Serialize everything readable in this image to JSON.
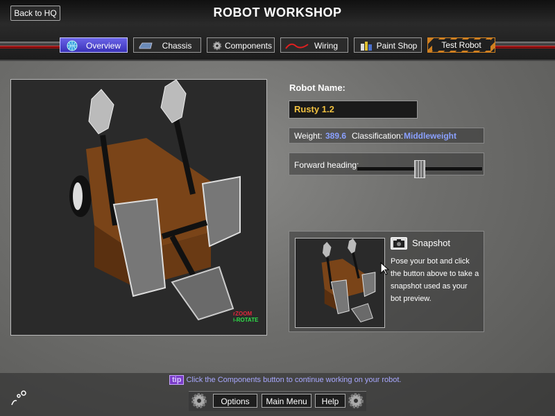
{
  "header": {
    "title": "ROBOT WORKSHOP",
    "back_label": "Back to HQ"
  },
  "tabs": [
    {
      "label": "Overview",
      "icon": "globe-icon",
      "active": true
    },
    {
      "label": "Chassis",
      "icon": "chassis-icon",
      "active": false
    },
    {
      "label": "Components",
      "icon": "gear-icon",
      "active": false
    },
    {
      "label": "Wiring",
      "icon": "wire-icon",
      "active": false
    },
    {
      "label": "Paint Shop",
      "icon": "paint-cans-icon",
      "active": false
    },
    {
      "label": "Test Robot",
      "icon": "",
      "active": false
    }
  ],
  "viewport": {
    "zoom_hint": "ZOOM",
    "rotate_hint": "ROTATE",
    "mouse_icon": "mouse-icon"
  },
  "robot": {
    "name_label": "Robot Name:",
    "name_value": "Rusty 1.2",
    "weight_label": "Weight:",
    "weight_value": "389.6",
    "class_label": "Classification:",
    "class_value": "Middleweight",
    "heading_label": "Forward heading:",
    "heading_level": 0.5
  },
  "snapshot": {
    "title": "Snapshot",
    "description": "Pose your bot and click the button above to take a snapshot used as your bot preview."
  },
  "footer": {
    "tip_badge": "tip",
    "tip_text": "Click the Components button to continue working on your robot.",
    "options_label": "Options",
    "main_menu_label": "Main Menu",
    "help_label": "Help"
  },
  "colors": {
    "active_tab": "#5048d8",
    "accent_value": "#8aa0ff",
    "robot_name": "#f0c040"
  }
}
